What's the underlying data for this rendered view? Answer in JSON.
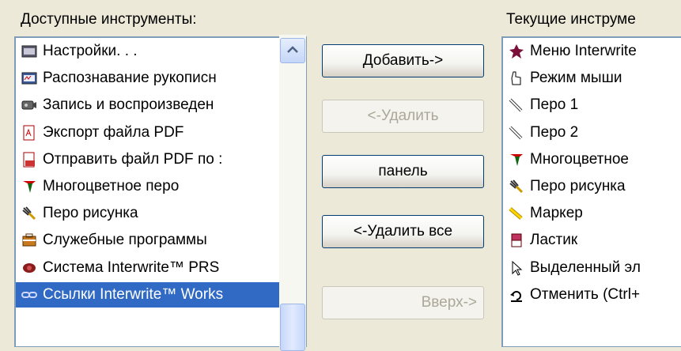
{
  "labels": {
    "available": "Доступные инструменты:",
    "current": "Текущие инструме"
  },
  "available_tools": [
    {
      "label": "Настройки. . .",
      "icon": "settings-window-icon"
    },
    {
      "label": "Распознавание рукописн",
      "icon": "handwriting-recognition-icon"
    },
    {
      "label": "Запись и воспроизведен",
      "icon": "record-playback-icon"
    },
    {
      "label": "Экспорт файла PDF",
      "icon": "pdf-export-icon"
    },
    {
      "label": "Отправить файл PDF по :",
      "icon": "pdf-send-icon"
    },
    {
      "label": "Многоцветное перо",
      "icon": "multicolor-pen-icon"
    },
    {
      "label": "Перо рисунка",
      "icon": "drawing-pen-icon"
    },
    {
      "label": "Служебные программы",
      "icon": "utilities-icon"
    },
    {
      "label": "Система Interwrite™ PRS",
      "icon": "prs-system-icon"
    },
    {
      "label": "Ссылки Interwrite™ Works",
      "icon": "links-icon",
      "selected": true
    }
  ],
  "current_tools": [
    {
      "label": "Меню Interwrite",
      "icon": "interwrite-menu-icon"
    },
    {
      "label": "Режим мыши",
      "icon": "mouse-mode-icon"
    },
    {
      "label": "Перо 1",
      "icon": "pen-1-icon"
    },
    {
      "label": "Перо 2",
      "icon": "pen-2-icon"
    },
    {
      "label": "Многоцветное",
      "icon": "multicolor-pen-icon"
    },
    {
      "label": "Перо рисунка",
      "icon": "drawing-pen-icon"
    },
    {
      "label": "Маркер",
      "icon": "marker-icon"
    },
    {
      "label": "Ластик",
      "icon": "eraser-icon"
    },
    {
      "label": "Выделенный эл",
      "icon": "selection-pointer-icon"
    },
    {
      "label": "Отменить (Ctrl+",
      "icon": "undo-icon"
    }
  ],
  "buttons": {
    "add": "Добавить->",
    "remove": "<-Удалить",
    "toolbar_label": "панель",
    "remove_all": "<-Удалить все",
    "up": "Вверх->"
  },
  "colors": {
    "selection": "#316ac5",
    "list_border": "#7f9db9",
    "dialog_bg": "#ece9d8"
  }
}
